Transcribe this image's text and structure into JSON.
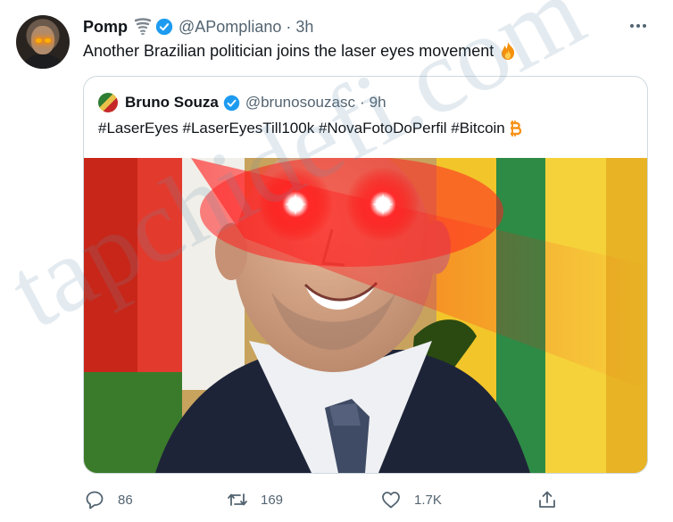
{
  "tweet": {
    "display_name": "Pomp",
    "handle": "@APompliano",
    "separator": "·",
    "time": "3h",
    "text": "Another Brazilian politician joins the laser eyes movement",
    "icons": [
      "tornado-emoji-icon",
      "verified-badge-icon",
      "more-options-icon",
      "fire-emoji-icon"
    ]
  },
  "quote": {
    "display_name": "Bruno Souza",
    "handle": "@brunosouzasc",
    "separator": "·",
    "time": "9h",
    "text": "#LaserEyes #LaserEyesTill100k #NovaFotoDoPerfil #Bitcoin",
    "icons": [
      "verified-badge-icon",
      "bitcoin-emoji-icon"
    ]
  },
  "actions": {
    "reply_count": "86",
    "retweet_count": "169",
    "like_count": "1.7K",
    "icons": [
      "reply-icon",
      "retweet-icon",
      "like-icon",
      "share-icon"
    ]
  },
  "watermark": "tapchidefi.com",
  "colors": {
    "text": "#0f1419",
    "secondary": "#536471",
    "verified": "#1d9bf0",
    "border": "#cfd9de",
    "laser": "#ff1a1a"
  }
}
